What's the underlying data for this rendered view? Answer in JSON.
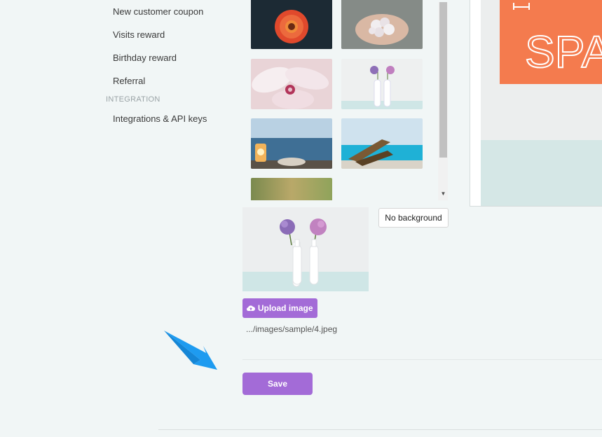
{
  "sidebar": {
    "items": [
      {
        "label": "New customer coupon"
      },
      {
        "label": "Visits reward"
      },
      {
        "label": "Birthday reward"
      },
      {
        "label": "Referral"
      }
    ],
    "section_integration": "INTEGRATION",
    "integration_items": [
      {
        "label": "Integrations & API keys"
      }
    ]
  },
  "gallery": {
    "thumbnails": [
      {
        "name": "red-gerbera-flower"
      },
      {
        "name": "hands-holding-flowers"
      },
      {
        "name": "pink-magnolia"
      },
      {
        "name": "vases-with-hydrangeas"
      },
      {
        "name": "lantern-by-sea"
      },
      {
        "name": "deckchair-by-pool"
      },
      {
        "name": "blurred-green"
      }
    ]
  },
  "preview": {
    "banner_text": "SPA",
    "banner_color": "#f47b4e"
  },
  "image_field": {
    "no_background_label": "No background",
    "upload_label": "Upload image",
    "path": ".../images/sample/4.jpeg"
  },
  "actions": {
    "save_label": "Save"
  },
  "colors": {
    "accent": "#a36bd7",
    "arrow": "#1e9bf0"
  }
}
